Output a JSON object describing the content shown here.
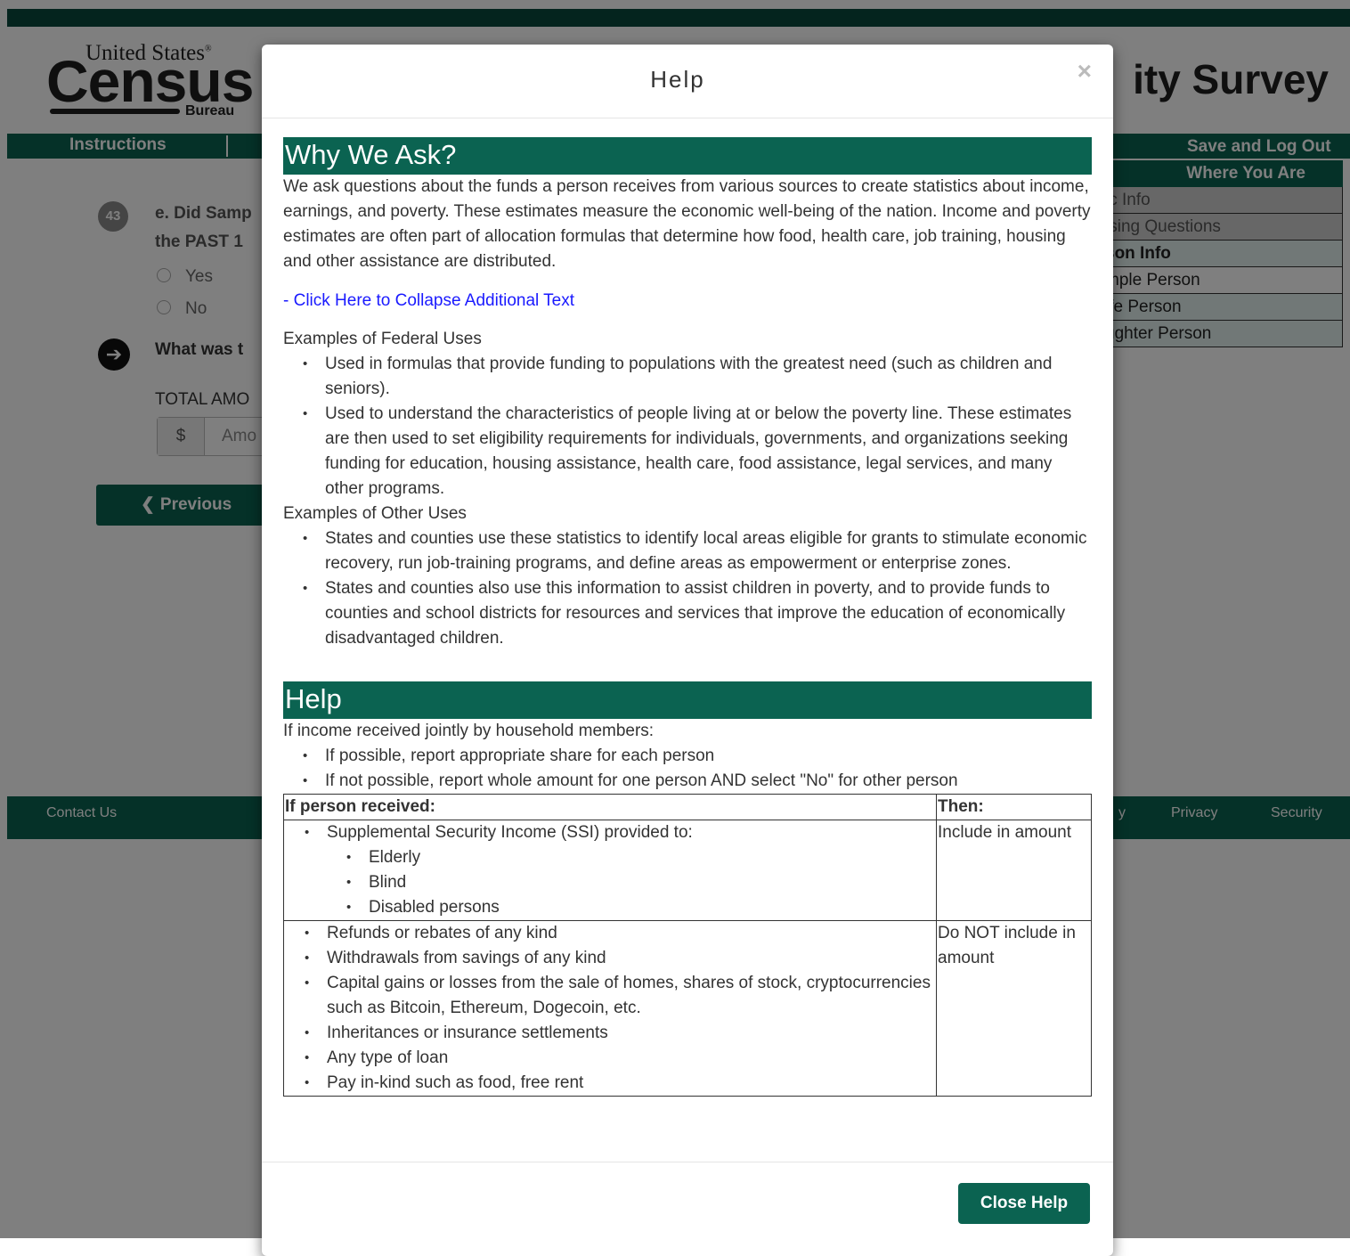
{
  "brand": {
    "united_states": "United States",
    "registered": "®",
    "census": "Census",
    "bureau": "Bureau"
  },
  "header": {
    "survey_title": "ity Survey"
  },
  "nav": {
    "instructions": "Instructions",
    "save_logout": "Save and Log Out"
  },
  "question": {
    "number": "43",
    "text_line1": "e. Did Samp",
    "text_line2": "the PAST 1",
    "options": [
      "Yes",
      "No"
    ],
    "followup": "What was t",
    "total_label": "TOTAL AMO",
    "currency": "$",
    "amount_placeholder": "Amo"
  },
  "buttons": {
    "previous": "Previous",
    "close_help": "Close Help"
  },
  "where_you_are": {
    "title": "Where You Are",
    "items": [
      "ic Info",
      "ising Questions",
      "son Info",
      "mple Person",
      "ife Person",
      "ughter Person"
    ]
  },
  "footer": {
    "contact": "Contact Us",
    "accessibility_frag": "y",
    "privacy": "Privacy",
    "security": "Security"
  },
  "modal": {
    "title": "Help",
    "close_symbol": "×",
    "why_heading": "Why We Ask?",
    "why_text": "We ask questions about the funds a person receives from various sources to create statistics about income, earnings, and poverty. These estimates measure the economic well-being of the nation. Income and poverty estimates are often part of allocation formulas that determine how food, health care, job training, housing and other assistance are distributed.",
    "collapse_link": "- Click Here to Collapse Additional Text",
    "federal_title": "Examples of Federal Uses",
    "federal_items": [
      "Used in formulas that provide funding to populations with the greatest need (such as children and seniors).",
      "Used to understand the characteristics of people living at or below the poverty line. These estimates are then used to set eligibility requirements for individuals, governments, and organizations seeking funding for education, housing assistance, health care, food assistance, legal services, and many other programs."
    ],
    "other_title": "Examples of Other Uses",
    "other_items": [
      "States and counties use these statistics to identify local areas eligible for grants to stimulate economic recovery, run job-training programs, and define areas as empowerment or enterprise zones.",
      "States and counties also use this information to assist children in poverty, and to provide funds to counties and school districts for resources and services that improve the education of economically disadvantaged children."
    ],
    "help_heading": "Help",
    "joint_intro": "If income received jointly by household members:",
    "joint_items": [
      "If possible, report appropriate share for each person",
      "If not possible, report whole amount for one person AND select \"No\" for other person"
    ],
    "table": {
      "col1": "If person received:",
      "col2": "Then:",
      "row1_item": "Supplemental Security Income (SSI) provided to:",
      "row1_sub": [
        "Elderly",
        "Blind",
        "Disabled persons"
      ],
      "row1_then": "Include in amount",
      "row2_items": [
        "Refunds or rebates of any kind",
        "Withdrawals from savings of any kind",
        "Capital gains or losses from the sale of homes, shares of stock, cryptocurrencies such as Bitcoin, Ethereum, Dogecoin, etc.",
        "Inheritances or insurance settlements",
        "Any type of loan",
        "Pay in-kind such as food, free rent"
      ],
      "row2_then": "Do NOT include in amount"
    }
  }
}
